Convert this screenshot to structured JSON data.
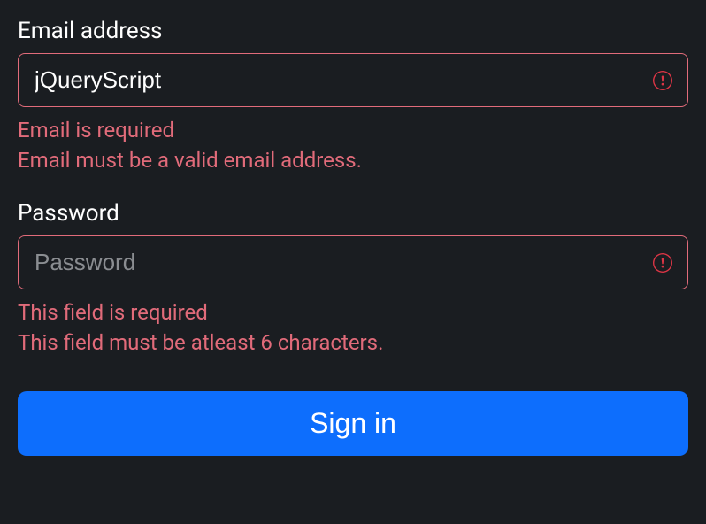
{
  "form": {
    "email": {
      "label": "Email address",
      "value": "jQueryScript",
      "placeholder": "",
      "errors": {
        "required": "Email is required",
        "valid": "Email must be a valid email address."
      }
    },
    "password": {
      "label": "Password",
      "value": "",
      "placeholder": "Password",
      "errors": {
        "required": "This field is required",
        "minlength": "This field must be atleast 6 characters."
      }
    },
    "submit": {
      "label": "Sign in"
    }
  },
  "colors": {
    "background": "#1a1d21",
    "error": "#e16b7a",
    "errorIcon": "#dc3545",
    "primary": "#0d6efd",
    "text": "#ffffff"
  }
}
